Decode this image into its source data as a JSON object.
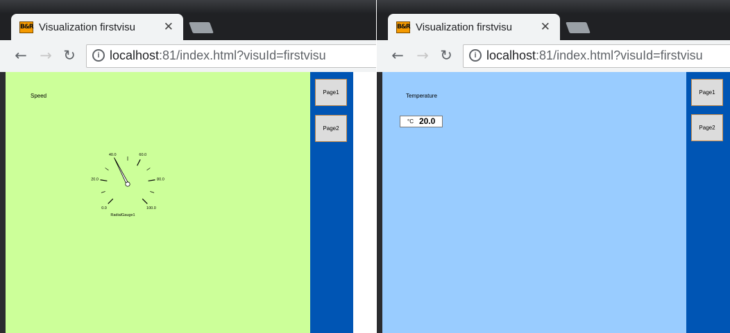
{
  "left_window": {
    "tab_title": "Visualization firstvisu",
    "favicon_text": "B&R",
    "url_host": "localhost",
    "url_rest": ":81/index.html?visuId=firstvisu",
    "page_bg": "#ccff99",
    "sidebar_bg": "#0055b4",
    "nav": {
      "page1": "Page1",
      "page2": "Page2"
    },
    "content": {
      "label": "Speed",
      "gauge": {
        "name": "RadialGauge1",
        "min": 0,
        "max": 100,
        "value": 40,
        "tick_labels": [
          "0.0",
          "20.0",
          "40.0",
          "60.0",
          "80.0",
          "100.0"
        ]
      }
    }
  },
  "right_window": {
    "tab_title": "Visualization firstvisu",
    "favicon_text": "B&R",
    "url_host": "localhost",
    "url_rest": ":81/index.html?visuId=firstvisu",
    "page_bg": "#99ccff",
    "sidebar_bg": "#0055b4",
    "nav": {
      "page1": "Page1",
      "page2": "Page2"
    },
    "content": {
      "label": "Temperature",
      "numeric": {
        "unit": "°C",
        "value": "20.0"
      }
    }
  }
}
